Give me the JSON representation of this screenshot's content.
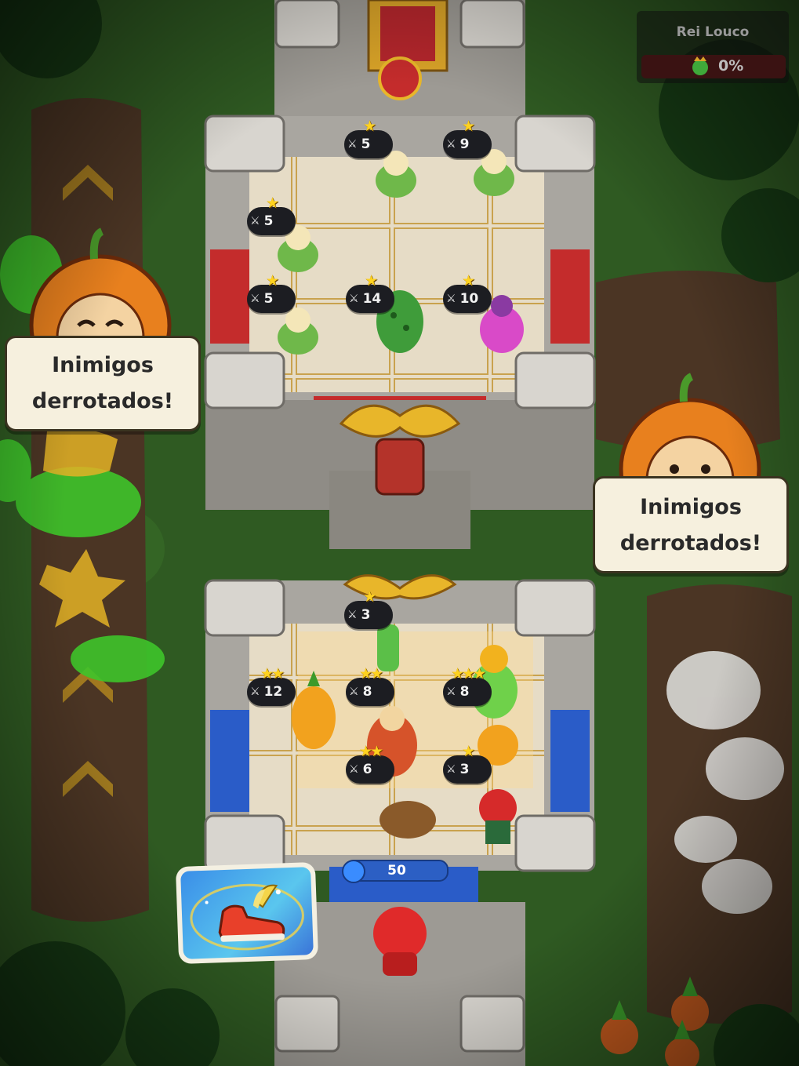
{
  "boss": {
    "name": "Rei Louco",
    "progress_label": "0%",
    "progress": 0
  },
  "bubbles": {
    "left": "Inimigos\nderrotados!",
    "right": "Inimigos\nderrotados!"
  },
  "enemy_units": [
    {
      "stars": "★",
      "power": "5"
    },
    {
      "stars": "★",
      "power": "9"
    },
    {
      "stars": "★",
      "power": "5"
    },
    {
      "stars": "★",
      "power": "5"
    },
    {
      "stars": "★",
      "power": "14"
    },
    {
      "stars": "★",
      "power": "10"
    }
  ],
  "player_units": [
    {
      "stars": "★",
      "power": "3"
    },
    {
      "stars": "★★",
      "power": "12"
    },
    {
      "stars": "★★",
      "power": "8"
    },
    {
      "stars": "★★★",
      "power": "8"
    },
    {
      "stars": "★★",
      "power": "6"
    },
    {
      "stars": "★",
      "power": "3"
    }
  ],
  "energy": {
    "value": "50"
  },
  "powerup": {
    "icon": "winged-shoe-icon"
  },
  "colors": {
    "enemy_banner": "#c42c2c",
    "player_banner": "#2a5cc8",
    "grass": "#2f5a22",
    "path": "#4b3524",
    "stone": "#b9b6b0"
  }
}
